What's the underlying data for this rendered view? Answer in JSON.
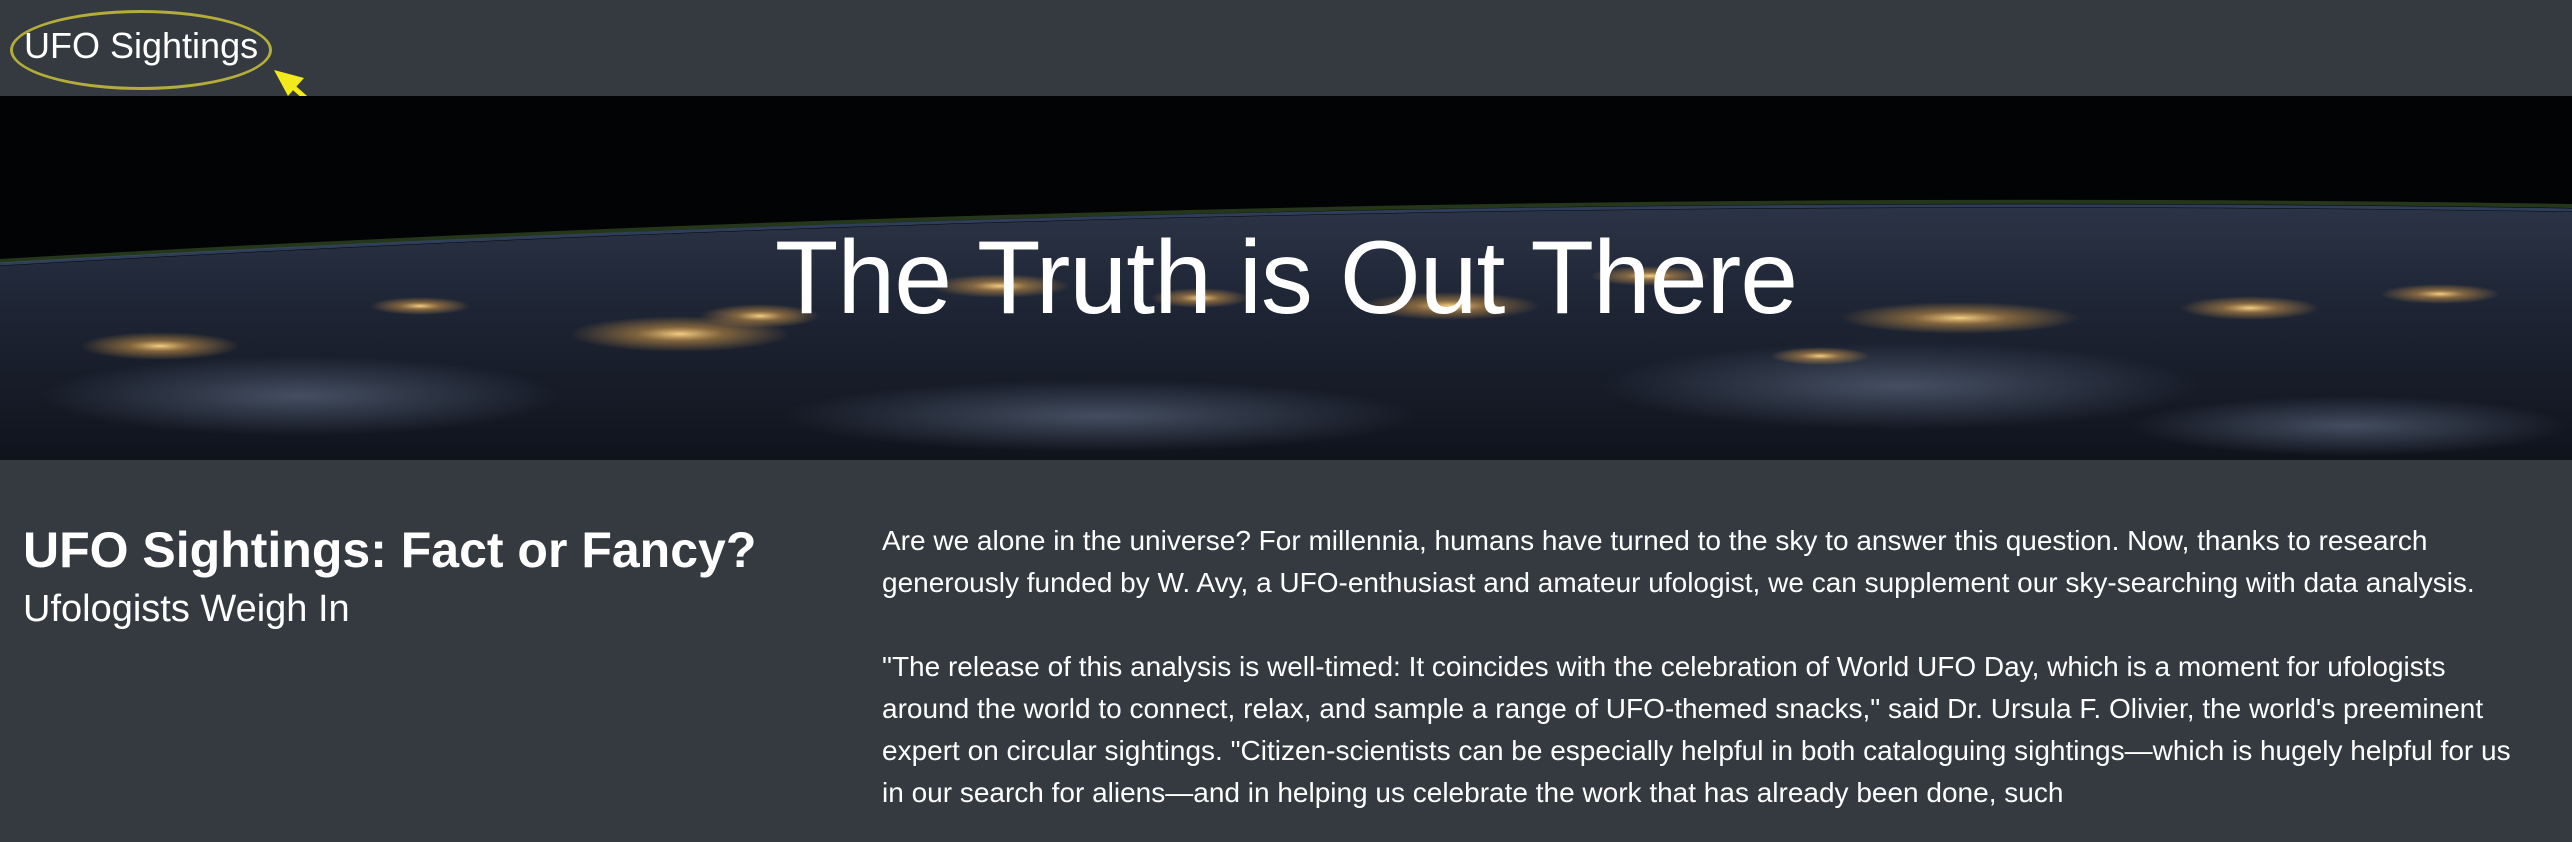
{
  "navbar": {
    "brand": "UFO Sightings"
  },
  "colors": {
    "page_background": "#343a40",
    "annotation": "#f2ea1c",
    "text": "#ffffff"
  },
  "hero": {
    "title": "The Truth is Out There"
  },
  "article": {
    "headline": "UFO Sightings: Fact or Fancy?",
    "subheadline": "Ufologists Weigh In",
    "paragraphs": [
      "Are we alone in the universe? For millennia, humans have turned to the sky to answer this question. Now, thanks to research generously funded by W. Avy, a UFO-enthusiast and amateur ufologist, we can supplement our sky-searching with data analysis.",
      "\"The release of this analysis is well-timed: It coincides with the celebration of World UFO Day, which is a moment for ufologists around the world to connect, relax, and sample a range of UFO-themed snacks,\" said Dr. Ursula F. Olivier, the world's preeminent expert on circular sightings. \"Citizen-scientists can be especially helpful in both cataloguing sightings—which is hugely helpful for us in our search for aliens—and in helping us celebrate the work that has already been done, such"
    ]
  }
}
